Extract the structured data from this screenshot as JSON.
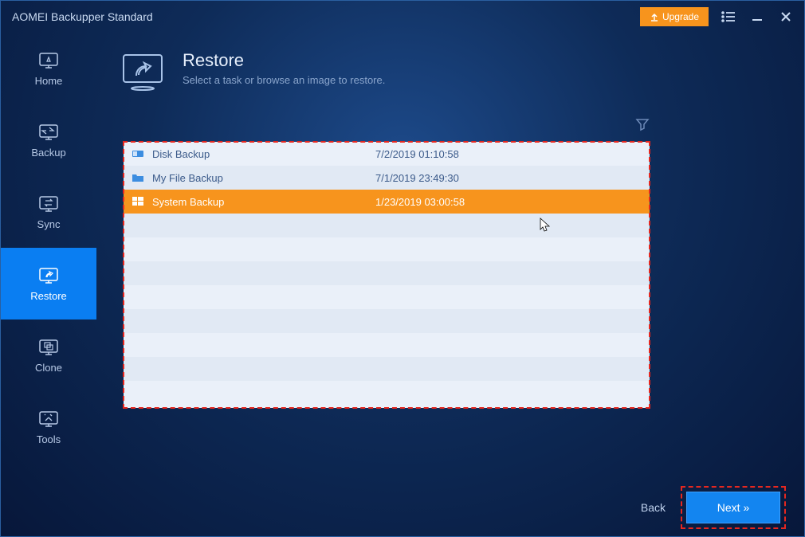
{
  "titlebar": {
    "title": "AOMEI Backupper Standard",
    "upgrade_label": "Upgrade"
  },
  "sidebar": {
    "items": [
      {
        "label": "Home"
      },
      {
        "label": "Backup"
      },
      {
        "label": "Sync"
      },
      {
        "label": "Restore"
      },
      {
        "label": "Clone"
      },
      {
        "label": "Tools"
      }
    ]
  },
  "page": {
    "title": "Restore",
    "subtitle": "Select a task or browse an image to restore."
  },
  "tasks": [
    {
      "name": "Disk Backup",
      "date": "7/2/2019 01:10:58",
      "selected": false
    },
    {
      "name": "My File Backup",
      "date": "7/1/2019 23:49:30",
      "selected": false
    },
    {
      "name": "System Backup",
      "date": "1/23/2019 03:00:58",
      "selected": true
    }
  ],
  "footer": {
    "back_label": "Back",
    "next_label": "Next »"
  }
}
